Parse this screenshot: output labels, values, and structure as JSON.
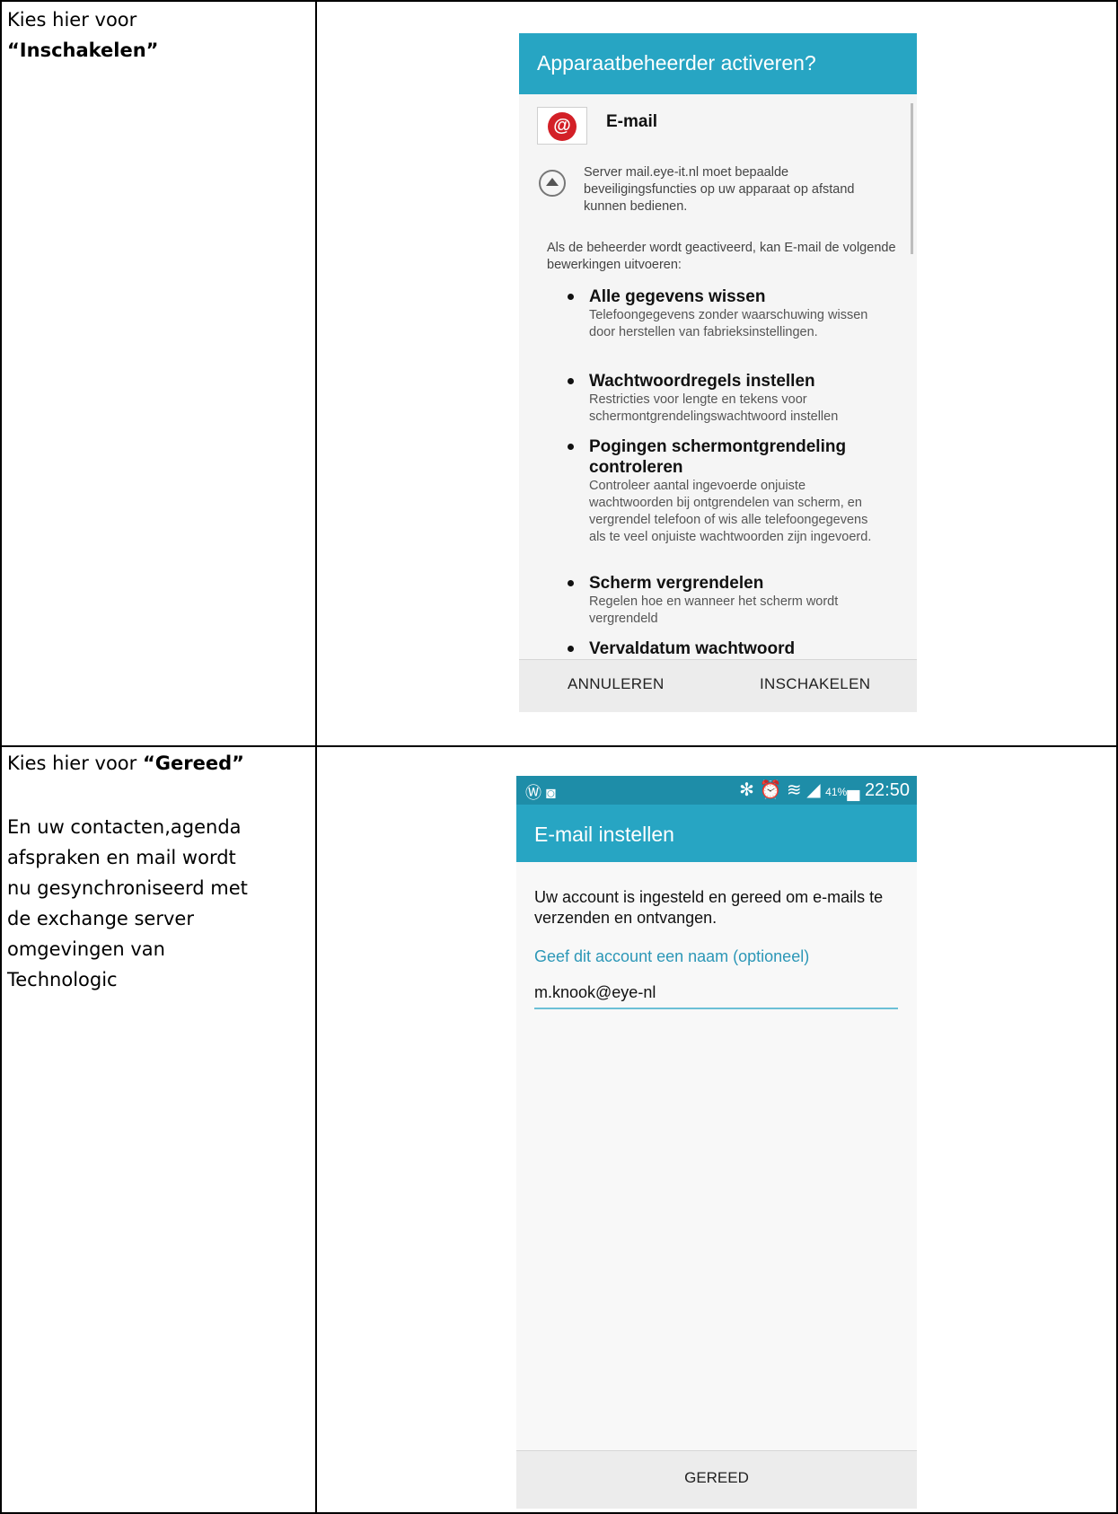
{
  "row1": {
    "instruction_prefix": "Kies hier voor",
    "instruction_bold": "“Inschakelen”"
  },
  "row2": {
    "instruction_prefix": "Kies hier voor",
    "instruction_bold": "“Gereed”",
    "note_lines": [
      "En uw contacten,agenda",
      "afspraken en mail wordt",
      "nu gesynchroniseerd met",
      "de exchange server",
      "omgevingen van",
      "Technologic"
    ]
  },
  "dialog": {
    "title": "Apparaatbeheerder activeren?",
    "app_icon": "email-at-icon",
    "app_name": "E-mail",
    "server_text": "Server mail.eye-it.nl moet bepaalde beveiligingsfuncties op uw apparaat op afstand kunnen bedienen.",
    "intro_text": "Als de beheerder wordt geactiveerd, kan E-mail de volgende bewerkingen uitvoeren:",
    "permissions": [
      {
        "title": "Alle gegevens wissen",
        "desc": "Telefoongegevens zonder waarschuwing wissen door herstellen van fabrieksinstellingen."
      },
      {
        "title": "Wachtwoordregels instellen",
        "desc": "Restricties voor lengte en tekens voor schermontgrendelingswachtwoord instellen"
      },
      {
        "title": "Pogingen schermontgrendeling controleren",
        "desc": "Controleer aantal ingevoerde onjuiste wachtwoorden bij ontgrendelen van scherm, en vergrendel telefoon of wis alle telefoongegevens als te veel onjuiste wachtwoorden zijn ingevoerd."
      },
      {
        "title": "Scherm vergrendelen",
        "desc": "Regelen hoe en wanneer het scherm wordt vergrendeld"
      },
      {
        "title": "Vervaldatum wachtwoord",
        "desc": ""
      }
    ],
    "cancel_label": "ANNULEREN",
    "enable_label": "INSCHAKELEN"
  },
  "setup": {
    "status_left": "Ⓦ ◙",
    "status_right_icons": "✻ ⏰ ≋ ◢",
    "battery": "41%",
    "battery_icon": "▄",
    "time": "22:50",
    "title": "E-mail instellen",
    "message": "Uw account is ingesteld en gereed om e-mails te verzenden en ontvangen.",
    "name_label": "Geef dit account een naam (optioneel)",
    "name_value": "m.knook@eye-nl",
    "done_label": "GEREED"
  },
  "colors": {
    "header": "#27a5c3",
    "status_bar": "#1e8da8",
    "accent_text": "#2c97b7",
    "button_bar": "#ececec"
  }
}
